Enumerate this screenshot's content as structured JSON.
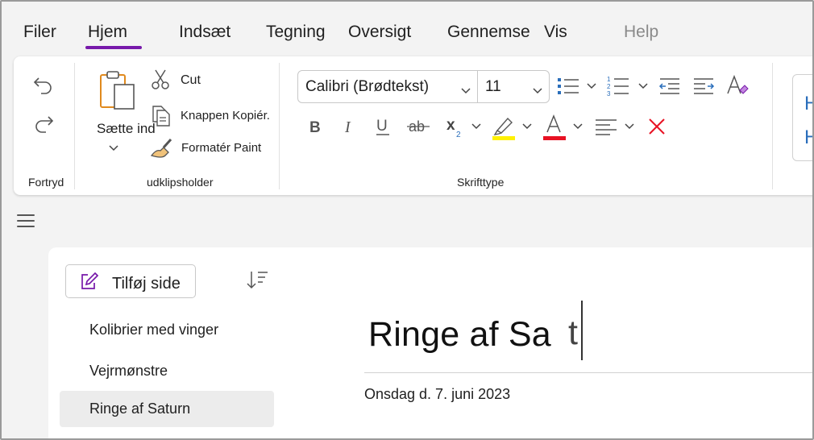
{
  "menu": {
    "tabs": [
      {
        "label": "Filer"
      },
      {
        "label": "Hjem"
      },
      {
        "label": "Indsæt"
      },
      {
        "label": "Tegning"
      },
      {
        "label": "Oversigt"
      },
      {
        "label": "Gennemse"
      },
      {
        "label": "Vis"
      },
      {
        "label": "Help"
      }
    ],
    "active_tab": "Hjem",
    "accent_color": "#7719aa"
  },
  "ribbon": {
    "undo_group": {
      "label": "Fortryd",
      "icons": [
        "undo-icon",
        "redo-icon"
      ]
    },
    "clipboard": {
      "label": "udklipsholder",
      "paste_label": "Sætte ind",
      "cut_label": "Cut",
      "copy_label": "Knappen Kopiér.",
      "format_paint_label": "Formatér Paint"
    },
    "font": {
      "label": "Skrifttype",
      "font_name": "Calibri (Brødtekst)",
      "font_size": "11",
      "highlight_color": "#fff100",
      "font_color": "#e81123",
      "clear_color": "#e81123"
    },
    "styles_preview": {
      "line1": "H",
      "line2": "H"
    }
  },
  "pages": {
    "add_label": "Tilføj side",
    "items": [
      {
        "label": "Kolibrier med vinger"
      },
      {
        "label": "Vejrmønstre"
      },
      {
        "label": "Ringe af Saturn"
      }
    ],
    "selected_index": 2
  },
  "note": {
    "title": "Ringe af Sa",
    "title_typed_char": "t",
    "date": "Onsdag d. 7. juni 2023"
  }
}
